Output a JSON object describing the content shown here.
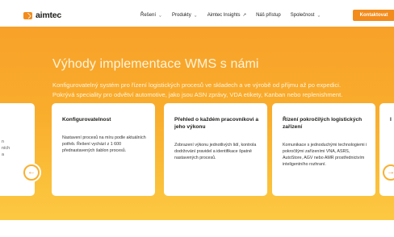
{
  "header": {
    "logo_text": "aimtec",
    "nav": [
      {
        "label": "Řešení",
        "icon": "chevron-down-icon"
      },
      {
        "label": "Produkty",
        "icon": "chevron-down-icon"
      },
      {
        "label": "Aimtec Insights",
        "icon": "external-link-icon"
      },
      {
        "label": "Náš přístup",
        "icon": ""
      },
      {
        "label": "Společnost",
        "icon": "chevron-down-icon"
      }
    ],
    "cta_label": "Kontaktovat"
  },
  "hero": {
    "title": "Výhody implementace WMS s námi",
    "description": "Konfigurovatelný systém pro řízení logistických procesů ve skladech a ve výrobě od příjmu až po expedici. Pokrývá speciality pro odvětví automotive, jako jsou ASN zprávy, VDA etikety, Kanban nebo replenishment."
  },
  "carousel": {
    "partial_left_lines": [
      "n",
      "ních",
      "a"
    ],
    "partial_right_title": "I",
    "prev_icon": "arrow-left-icon",
    "next_icon": "arrow-right-icon",
    "cards": [
      {
        "title": "Konfigurovatelnost",
        "body": "Nastavení procesů na míru podle aktuálních potřeb. Řešení vychází z 1 600 přednastavených šablon procesů."
      },
      {
        "title": "Přehled o každém pracovníkovi a jeho výkonu",
        "body": "Zobrazení výkonu jednotlivých lidí, kontrola dodržování pravidel a identifikace špatně nastavených procesů."
      },
      {
        "title": "Řízení pokročilých logistických zařízení",
        "body": "Komunikace s jednoduchými technologiemi i pokročilými zařízeními VNA, ASRS, AutoStore, AGV nebo AMR prostřednictvím inteligentního rozhraní."
      }
    ]
  },
  "colors": {
    "accent": "#f28c1d",
    "hero_top": "#f8a12a",
    "hero_bottom": "#fcc842"
  }
}
